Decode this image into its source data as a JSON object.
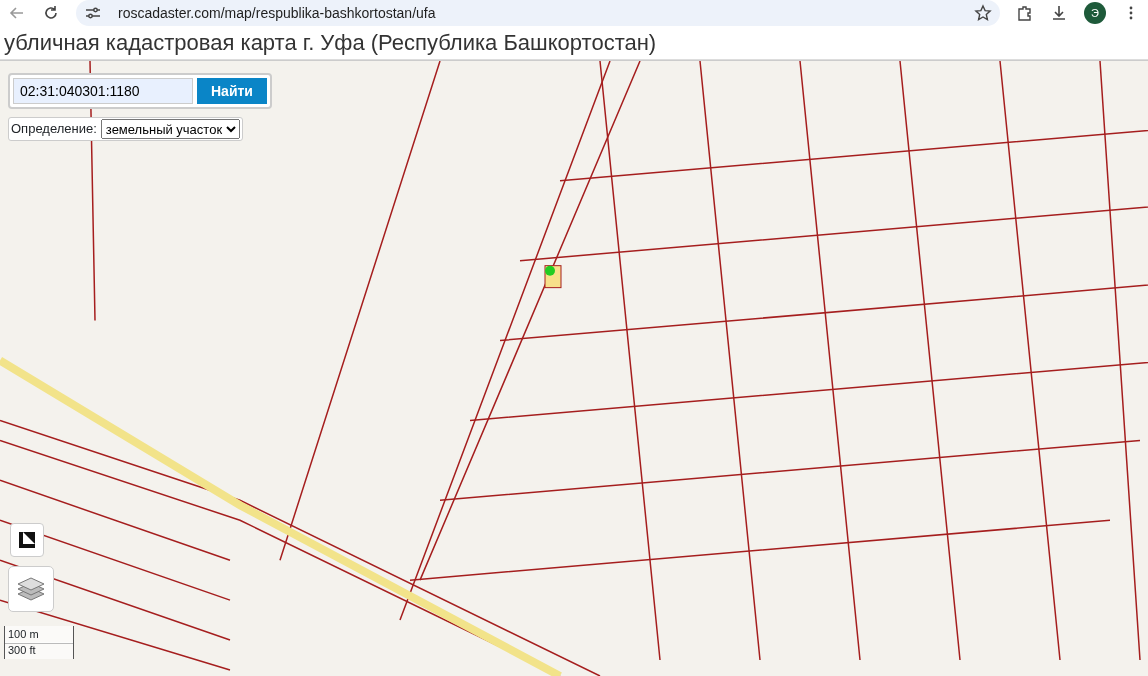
{
  "browser": {
    "url": "roscadaster.com/map/respublika-bashkortostan/ufa",
    "profile_initial": "Э"
  },
  "page": {
    "title": "убличная кадастровая карта г. Уфа (Республика Башкортостан)"
  },
  "search": {
    "value": "02:31:040301:1180",
    "button": "Найти"
  },
  "definition": {
    "label": "Определение:",
    "value": "земельный участок"
  },
  "scale": {
    "metric": "100 m",
    "imperial": "300 ft"
  }
}
